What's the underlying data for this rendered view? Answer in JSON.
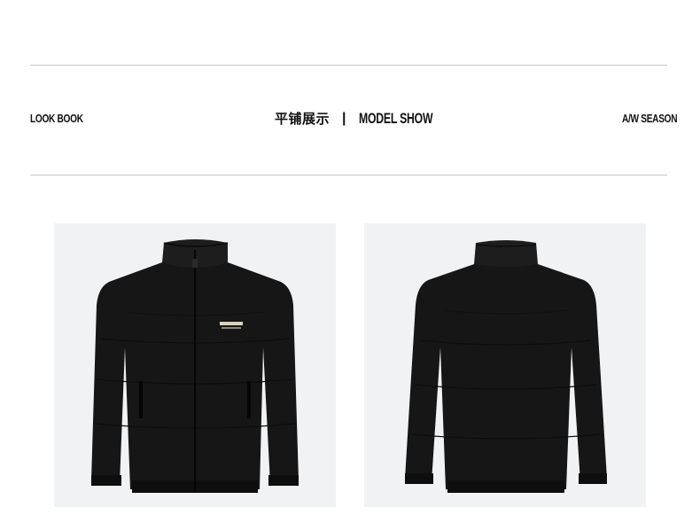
{
  "header": {
    "left_label": "LOOK BOOK",
    "title_cn": "平铺展示",
    "divider": "|",
    "title_en": "MODEL SHOW",
    "right_label": "A/W SEASON"
  },
  "colors": {
    "background": "#ffffff",
    "rule": "#c8c8c8",
    "photo_bg": "#f1f2f4",
    "jacket": "#161616"
  },
  "gallery": {
    "images": [
      {
        "name": "jacket-front-image",
        "view": "front",
        "brand_logo_text": "SEVENBRAND"
      },
      {
        "name": "jacket-back-image",
        "view": "back"
      }
    ]
  }
}
